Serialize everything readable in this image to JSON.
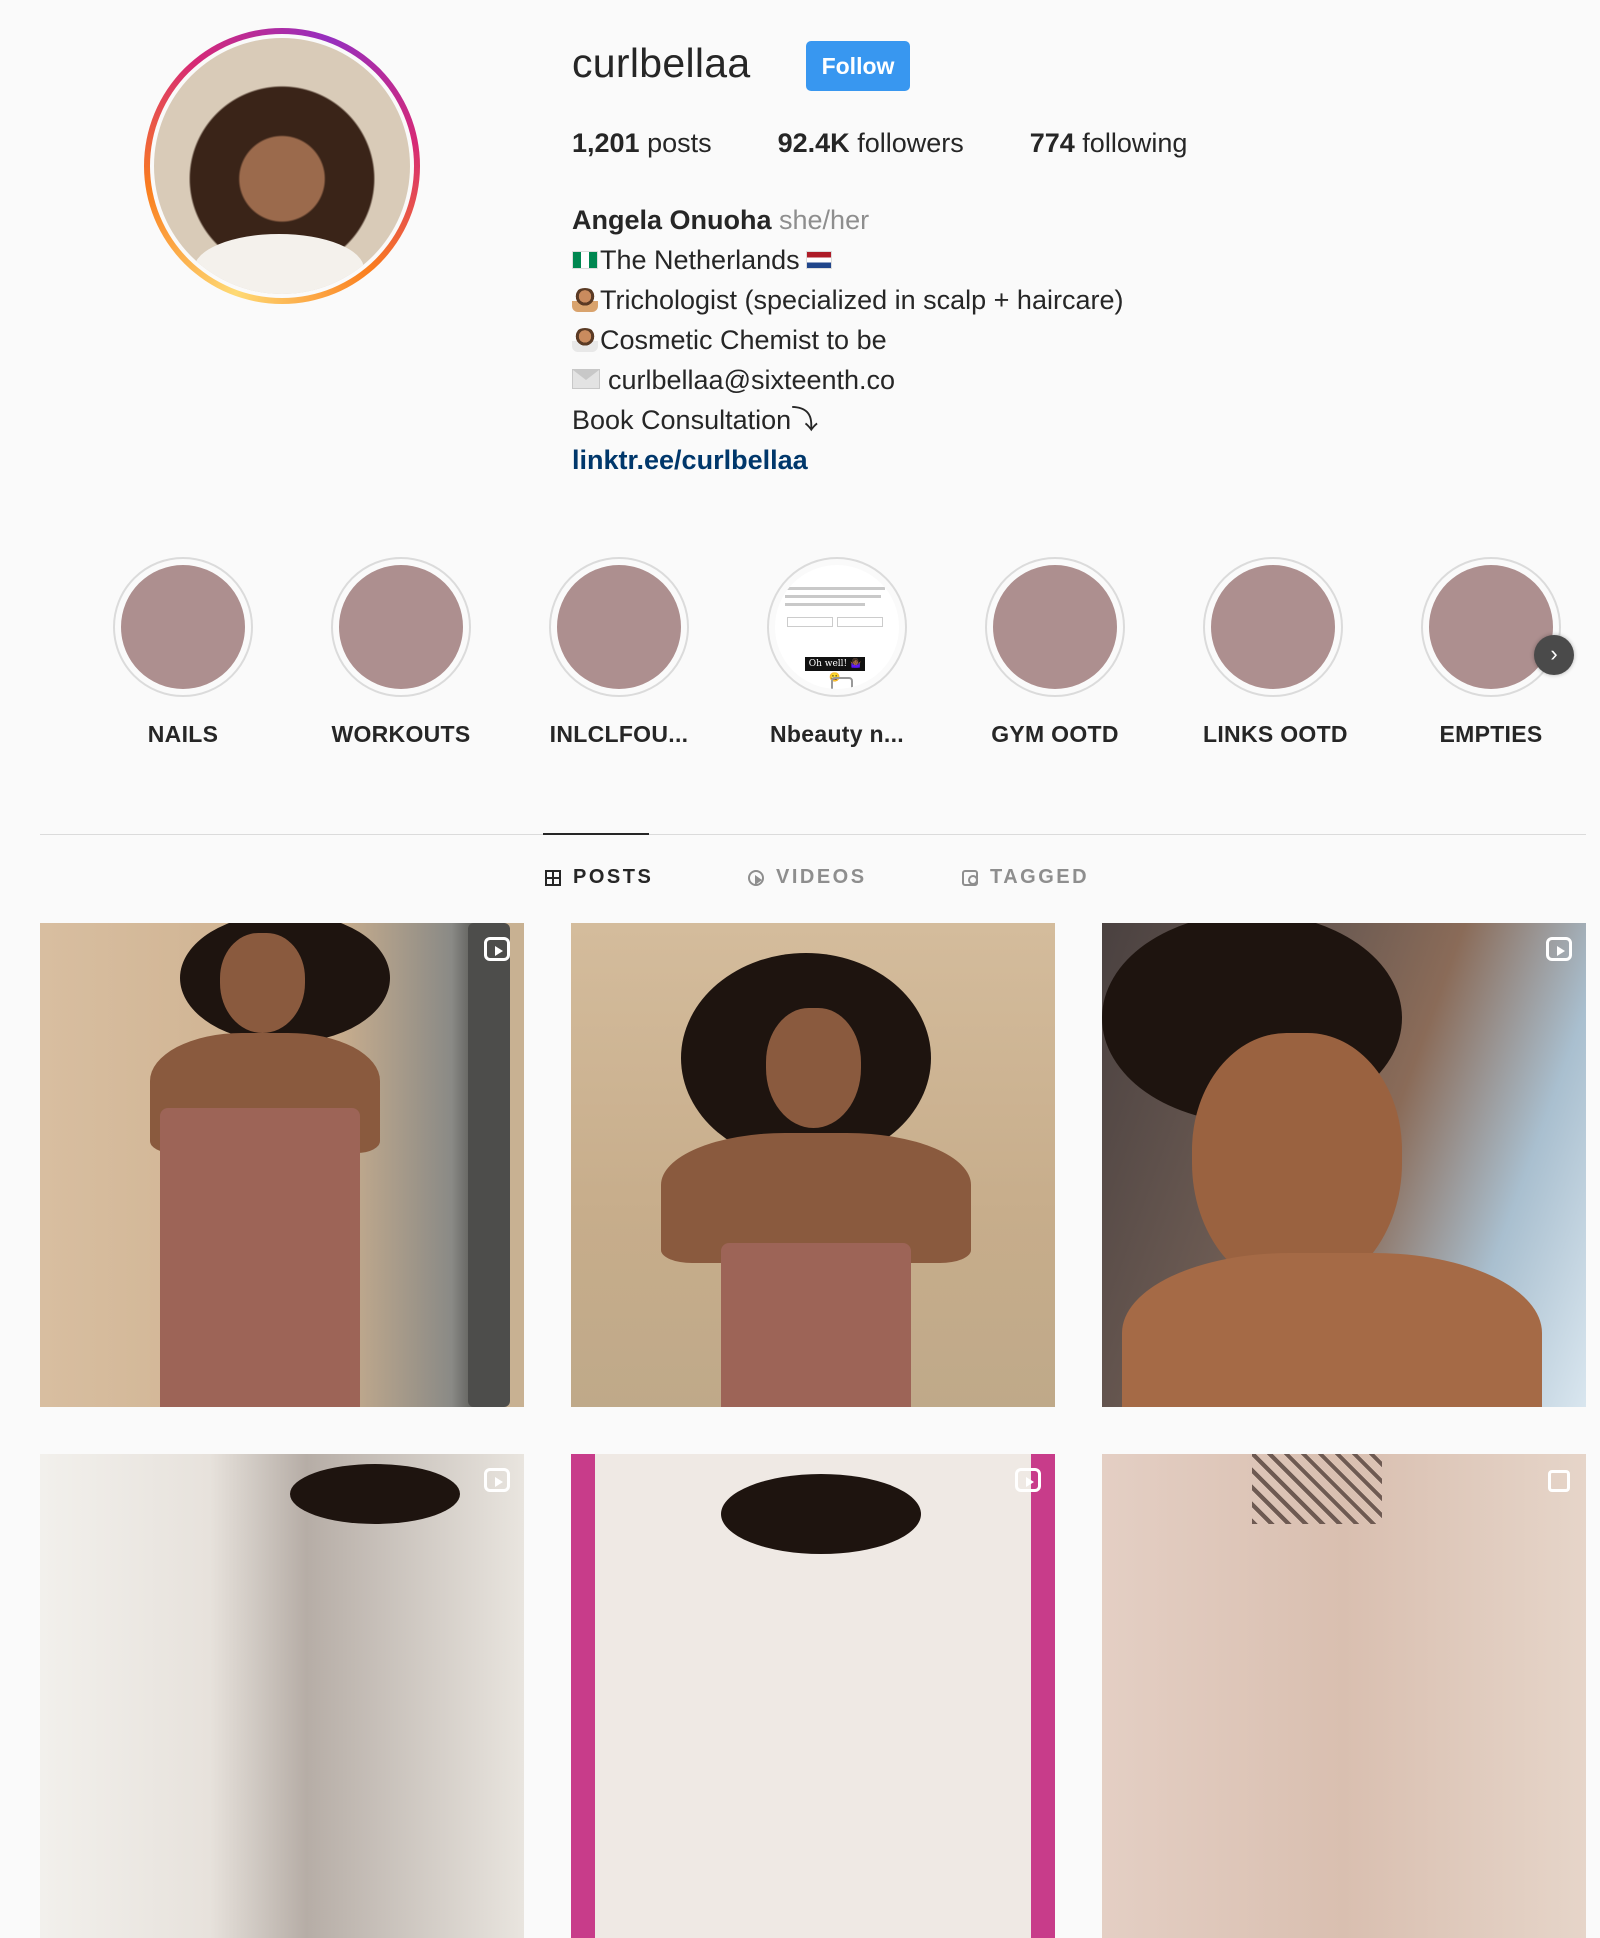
{
  "profile": {
    "username": "curlbellaa",
    "follow_label": "Follow",
    "stats": {
      "posts_count": "1,201",
      "posts_label": " posts",
      "followers_count": "92.4K",
      "followers_label": " followers",
      "following_count": "774",
      "following_label": " following"
    },
    "bio": {
      "name": "Angela Onuoha",
      "pronouns": " she/her",
      "line_location": "The Netherlands",
      "line_trichologist": "Trichologist (specialized in scalp + haircare)",
      "line_chemist": "Cosmetic Chemist to be",
      "line_email": "curlbellaa@sixteenth.co",
      "line_book": "Book Consultation⤵",
      "link": "linktr.ee/curlbellaa"
    }
  },
  "highlights": [
    {
      "label": "NAILS"
    },
    {
      "label": "WORKOUTS"
    },
    {
      "label": "INLCLFOU..."
    },
    {
      "label": "Nbeauty n...",
      "cover_caption": "Oh well! 🤷🏾‍♀️😀"
    },
    {
      "label": "GYM OOTD"
    },
    {
      "label": "LINKS OOTD"
    },
    {
      "label": "EMPTIES"
    }
  ],
  "tabs": {
    "posts": "POSTS",
    "videos": "VIDEOS",
    "tagged": "TAGGED",
    "active": "posts"
  },
  "posts": [
    {
      "type": "reel"
    },
    {
      "type": "photo"
    },
    {
      "type": "reel"
    },
    {
      "type": "reel"
    },
    {
      "type": "reel"
    },
    {
      "type": "carousel"
    }
  ],
  "colors": {
    "follow_button": "#3897f0",
    "link": "#00376b",
    "highlight_cover": "#ad8f8f",
    "secondary_text": "#8e8e8e"
  },
  "icons": [
    "tab-grid-icon",
    "tab-play-icon",
    "tab-tag-icon",
    "reel-icon",
    "carousel-icon",
    "chevron-right-icon",
    "envelope-icon"
  ]
}
